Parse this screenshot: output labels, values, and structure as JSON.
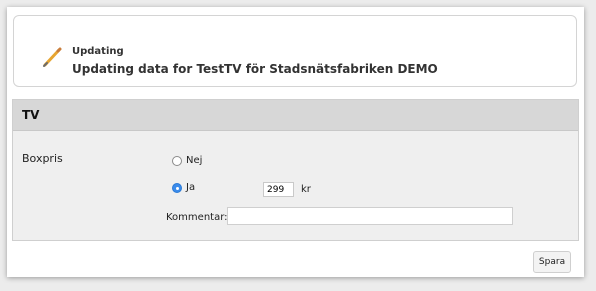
{
  "header": {
    "kicker": "Updating",
    "title": "Updating data for TestTV för Stadsnätsfabriken DEMO",
    "icon": "pencil-icon"
  },
  "panel": {
    "title": "TV",
    "field_label": "Boxpris",
    "options": [
      {
        "label": "Nej",
        "selected": false
      },
      {
        "label": "Ja",
        "selected": true
      }
    ],
    "price_value": "299",
    "currency": "kr",
    "comment_label": "Kommentar:",
    "comment_value": ""
  },
  "actions": {
    "save_label": "Spara"
  },
  "colors": {
    "accent": "#3b8beb",
    "panel_bg": "#efefef",
    "panel_head_bg": "#d7d7d7"
  }
}
